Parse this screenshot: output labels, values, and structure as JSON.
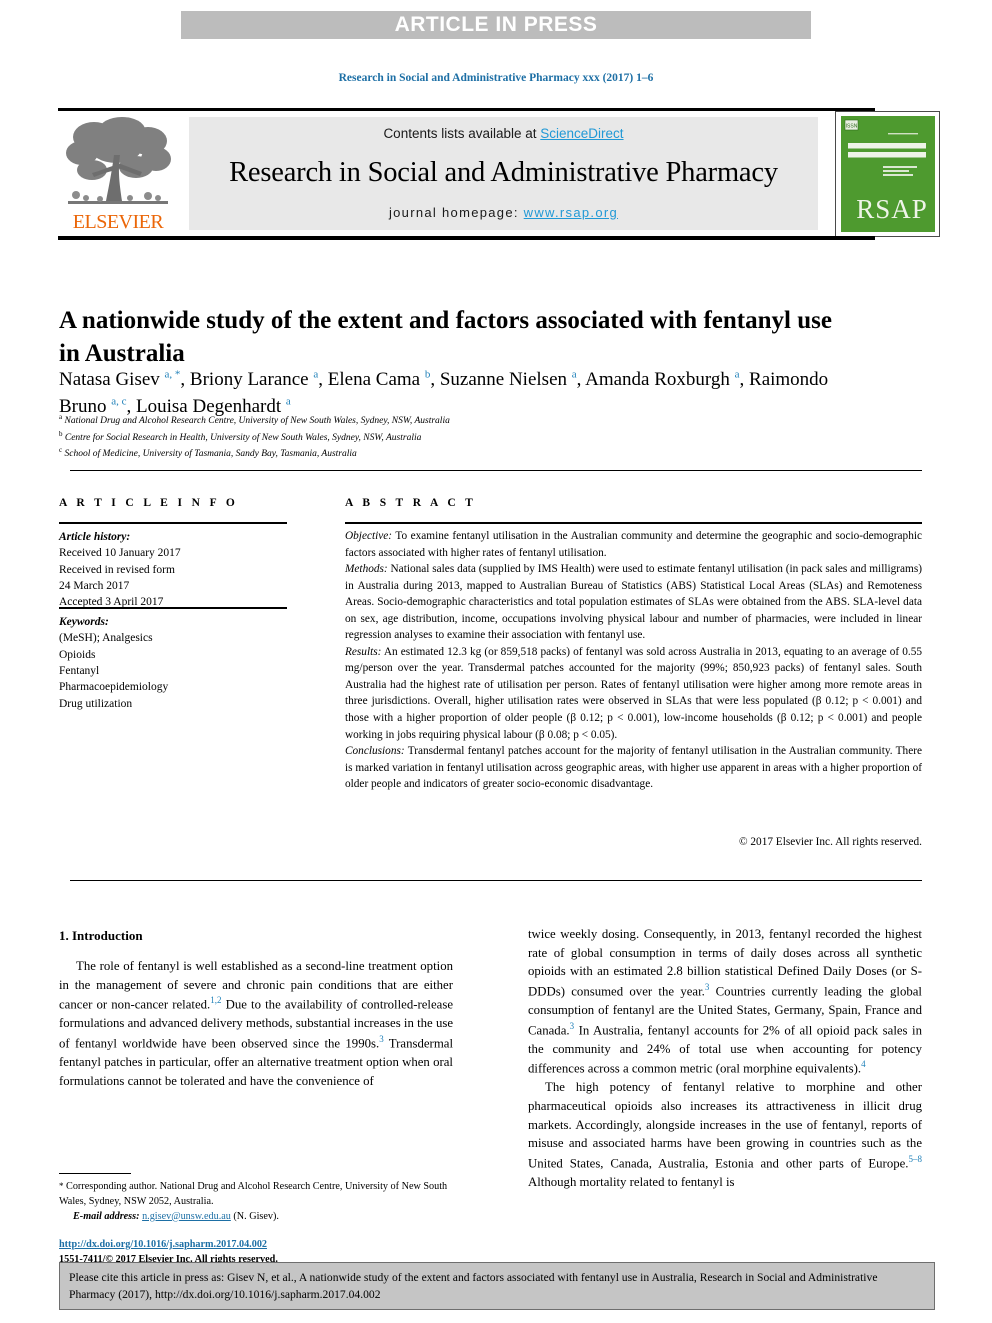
{
  "banner": {
    "text": "ARTICLE IN PRESS"
  },
  "journal_ref": "Research in Social and Administrative Pharmacy xxx (2017) 1–6",
  "masthead": {
    "publisher": "ELSEVIER",
    "contents_prefix": "Contents lists available at ",
    "contents_link": "ScienceDirect",
    "journal_title": "Research in Social and Administrative Pharmacy",
    "homepage_prefix": "journal homepage: ",
    "homepage_link": "www.rsap.org",
    "cover": {
      "badge": "ISSN",
      "top_small": "VOLUME  ·  NUMBER",
      "line1": "RESEARCH IN SOCIAL &",
      "line2": "ADMINISTRATIVE PHARMACY",
      "sub1": "The Official Journal of",
      "sub2": "Social and Administrative Pharmacy",
      "acronym": "RSAP"
    }
  },
  "article": {
    "title": "A nationwide study of the extent and factors associated with fentanyl use in Australia",
    "authors_html": "Natasa Gisev <sup>a, *</sup>, Briony Larance <sup>a</sup>, Elena Cama <sup>b</sup>, Suzanne Nielsen <sup>a</sup>, Amanda Roxburgh <sup>a</sup>, Raimondo Bruno <sup>a, c</sup>, Louisa Degenhardt <sup>a</sup>",
    "affiliations": [
      {
        "marker": "a",
        "text": "National Drug and Alcohol Research Centre, University of New South Wales, Sydney, NSW, Australia"
      },
      {
        "marker": "b",
        "text": "Centre for Social Research in Health, University of New South Wales, Sydney, NSW, Australia"
      },
      {
        "marker": "c",
        "text": "School of Medicine, University of Tasmania, Sandy Bay, Tasmania, Australia"
      }
    ]
  },
  "article_info": {
    "heading": "A R T I C L E  I N F O",
    "history_label": "Article history:",
    "history_lines": [
      "Received 10 January 2017",
      "Received in revised form",
      "24 March 2017",
      "Accepted 3 April 2017"
    ],
    "keywords_label": "Keywords:",
    "keywords": [
      "(MeSH); Analgesics",
      "Opioids",
      "Fentanyl",
      "Pharmacoepidemiology",
      "Drug utilization"
    ]
  },
  "abstract": {
    "heading": "A B S T R A C T",
    "objective_label": "Objective:",
    "objective_text": " To examine fentanyl utilisation in the Australian community and determine the geographic and socio-demographic factors associated with higher rates of fentanyl utilisation.",
    "methods_label": "Methods:",
    "methods_text": " National sales data (supplied by IMS Health) were used to estimate fentanyl utilisation (in pack sales and milligrams) in Australia during 2013, mapped to Australian Bureau of Statistics (ABS) Statistical Local Areas (SLAs) and Remoteness Areas. Socio-demographic characteristics and total population estimates of SLAs were obtained from the ABS. SLA-level data on sex, age distribution, income, occupations involving physical labour and number of pharmacies, were included in linear regression analyses to examine their association with fentanyl use.",
    "results_label": "Results:",
    "results_text": " An estimated 12.3 kg (or 859,518 packs) of fentanyl was sold across Australia in 2013, equating to an average of 0.55 mg/person over the year. Transdermal patches accounted for the majority (99%; 850,923 packs) of fentanyl sales. South Australia had the highest rate of utilisation per person. Rates of fentanyl utilisation were higher among more remote areas in three jurisdictions. Overall, higher utilisation rates were observed in SLAs that were less populated (β 0.12; p < 0.001) and those with a higher proportion of older people (β 0.12; p < 0.001), low-income households (β 0.12; p < 0.001) and people working in jobs requiring physical labour (β 0.08; p < 0.05).",
    "conclusions_label": "Conclusions:",
    "conclusions_text": " Transdermal fentanyl patches account for the majority of fentanyl utilisation in the Australian community. There is marked variation in fentanyl utilisation across geographic areas, with higher use apparent in areas with a higher proportion of older people and indicators of greater socio-economic disadvantage.",
    "copyright": "© 2017 Elsevier Inc. All rights reserved."
  },
  "body": {
    "intro_heading": "1. Introduction",
    "left_paragraph_html": "The role of fentanyl is well established as a second-line treatment option in the management of severe and chronic pain conditions that are either cancer or non-cancer related.<sup>1,2</sup> Due to the availability of controlled-release formulations and advanced delivery methods, substantial increases in the use of fentanyl worldwide have been observed since the 1990s.<sup>3</sup> Transdermal fentanyl patches in particular, offer an alternative treatment option when oral formulations cannot be tolerated and have the convenience of",
    "right_paragraph1_html": "twice weekly dosing. Consequently, in 2013, fentanyl recorded the highest rate of global consumption in terms of daily doses across all synthetic opioids with an estimated 2.8 billion statistical Defined Daily Doses (or S-DDDs) consumed over the year.<sup>3</sup> Countries currently leading the global consumption of fentanyl are the United States, Germany, Spain, France and Canada.<sup>3</sup> In Australia, fentanyl accounts for 2% of all opioid pack sales in the community and 24% of total use when accounting for potency differences across a common metric (oral morphine equivalents).<sup>4</sup>",
    "right_paragraph2_html": "The high potency of fentanyl relative to morphine and other pharmaceutical opioids also increases its attractiveness in illicit drug markets. Accordingly, alongside increases in the use of fentanyl, reports of misuse and associated harms have been growing in countries such as the United States, Canada, Australia, Estonia and other parts of Europe.<sup>5–8</sup> Although mortality related to fentanyl is"
  },
  "footnotes": {
    "corresponding_html": "<span class=\"fn-star\">*</span> Corresponding author. National Drug and Alcohol Research Centre, University of New South Wales, Sydney, NSW 2052, Australia.",
    "email_label": "E-mail address:",
    "email_link": "n.gisev@unsw.edu.au",
    "email_suffix": " (N. Gisev).",
    "doi_link": "http://dx.doi.org/10.1016/j.sapharm.2017.04.002",
    "issn_line": "1551-7411/© 2017 Elsevier Inc. All rights reserved."
  },
  "cite_box": {
    "text": "Please cite this article in press as: Gisev N, et al., A nationwide study of the extent and factors associated with fentanyl use in Australia, Research in Social and Administrative Pharmacy (2017), http://dx.doi.org/10.1016/j.sapharm.2017.04.002"
  },
  "colors": {
    "banner_bg": "#bcbcbc",
    "link_blue": "#2199d6",
    "ref_blue": "#1d6fa5",
    "elsevier_orange": "#eb6608",
    "cover_green": "#4e9a2f",
    "cite_bg": "#c5c5c5"
  }
}
